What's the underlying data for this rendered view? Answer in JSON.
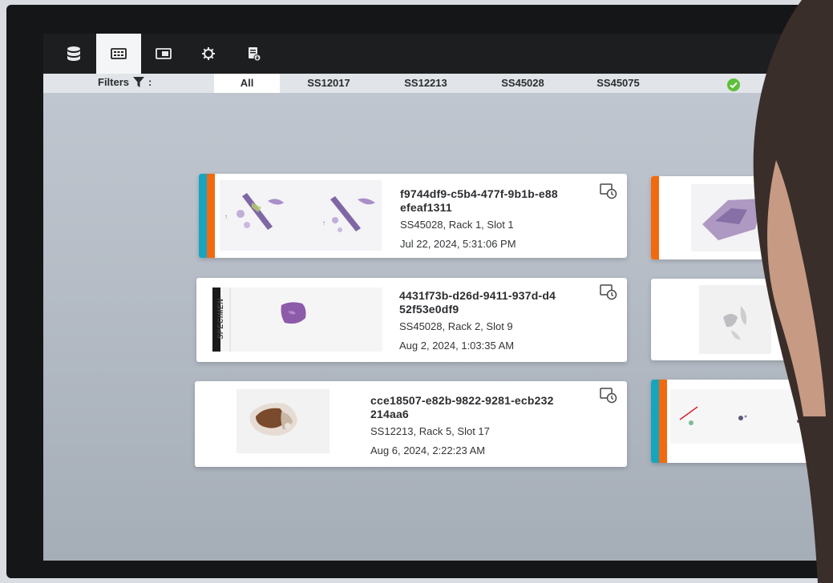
{
  "toolbar": {
    "items": [
      {
        "name": "database-icon"
      },
      {
        "name": "grid-view-icon",
        "active": true
      },
      {
        "name": "slide-view-icon"
      },
      {
        "name": "settings-icon"
      },
      {
        "name": "export-icon"
      }
    ]
  },
  "filters": {
    "label": "Filters",
    "colon": ":",
    "tabs": [
      "All",
      "SS12017",
      "SS12213",
      "SS45028",
      "SS45075"
    ],
    "active": "All"
  },
  "cards": [
    {
      "id_line1": "f9744df9-c5b4-477f-9b1b-e88",
      "id_line2": "efeaf1311",
      "location": "SS45028, Rack 1, Slot 1",
      "time": "Jul 22, 2024, 5:31:06 PM"
    },
    {
      "id_line1": "4431f73b-d26d-9411-937d-d4",
      "id_line2": "52f53e0df9",
      "location": "SS45028, Rack 2, Slot 9",
      "time": "Aug 2, 2024, 1:03:35 AM",
      "label_text": "SPECIMEN"
    },
    {
      "id_line1": "cce18507-e82b-9822-9281-ecb232",
      "id_line2": "214aa6",
      "location": "SS12213, Rack 5, Slot 17",
      "time": "Aug 6, 2024, 2:22:23 AM"
    }
  ],
  "colors": {
    "stripe_teal": "#17a5be",
    "stripe_orange": "#f26a10",
    "toolbar_bg": "#1d1e20"
  }
}
